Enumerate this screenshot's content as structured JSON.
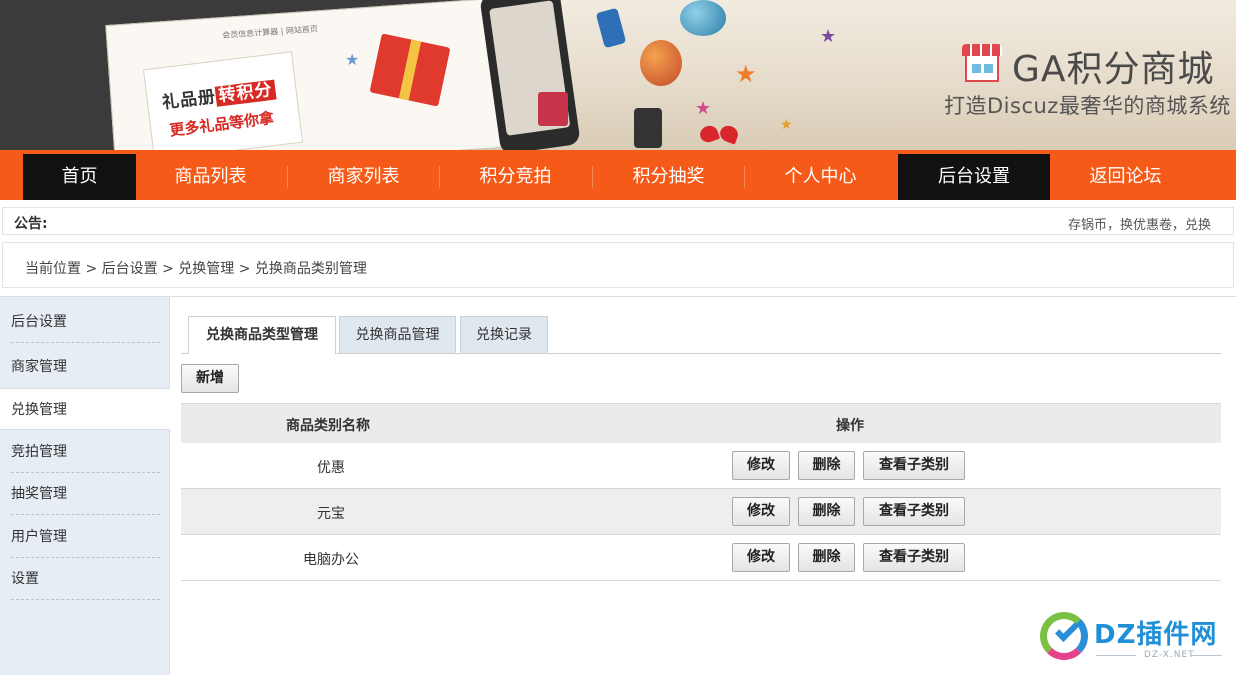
{
  "banner": {
    "screen_note": "会员信息计算器 | 网站首页",
    "gift_card_line1_prefix": "礼品册",
    "gift_card_line1_highlight": "转积分",
    "gift_card_line2": "更多礼品等你拿",
    "brand_title": "GA积分商城",
    "brand_subtitle": "打造Discuz最奢华的商城系统",
    "logo_icon": "shop-store-icon"
  },
  "nav": {
    "items": [
      {
        "label": "首页",
        "dark": true
      },
      {
        "label": "商品列表",
        "dark": false
      },
      {
        "label": "商家列表",
        "dark": false
      },
      {
        "label": "积分竞拍",
        "dark": false
      },
      {
        "label": "积分抽奖",
        "dark": false
      },
      {
        "label": "个人中心",
        "dark": false
      },
      {
        "label": "后台设置",
        "dark": true
      },
      {
        "label": "返回论坛",
        "dark": false
      }
    ],
    "colors": {
      "bar": "#f55a18",
      "active": "#111111"
    }
  },
  "notice": {
    "label": "公告:",
    "text": "存锅币，换优惠卷，兑换"
  },
  "breadcrumb": {
    "text": "当前位置  > 后台设置 > 兑换管理 > 兑换商品类别管理"
  },
  "sidebar": {
    "items": [
      {
        "label": "后台设置"
      },
      {
        "label": "商家管理"
      },
      {
        "label": "兑换管理"
      },
      {
        "label": "竞拍管理"
      },
      {
        "label": "抽奖管理"
      },
      {
        "label": "用户管理"
      },
      {
        "label": "设置"
      }
    ],
    "active": "兑换管理"
  },
  "tabs": [
    {
      "label": "兑换商品类型管理"
    },
    {
      "label": "兑换商品管理"
    },
    {
      "label": "兑换记录"
    }
  ],
  "toolbar": {
    "add_label": "新增"
  },
  "table": {
    "headers": [
      "商品类别名称",
      "操作"
    ],
    "actions": {
      "edit": "修改",
      "delete": "删除",
      "view_sub": "查看子类别"
    },
    "rows": [
      {
        "name": "优惠"
      },
      {
        "name": "元宝"
      },
      {
        "name": "电脑办公"
      }
    ]
  },
  "watermark": {
    "title": "DZ插件网",
    "subtitle": "DZ-X.NET"
  }
}
